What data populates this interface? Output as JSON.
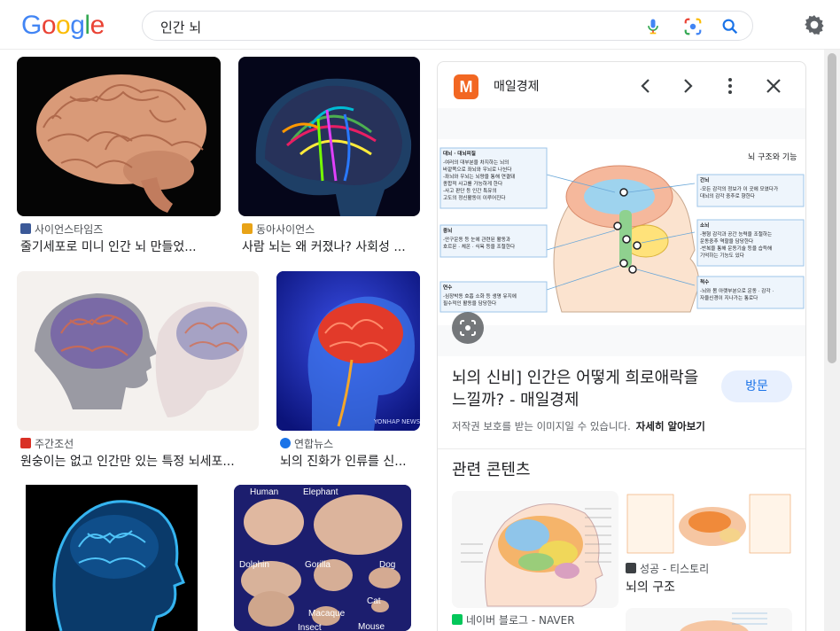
{
  "header": {
    "logo_letters": [
      "G",
      "o",
      "o",
      "g",
      "l",
      "e"
    ],
    "logo_colors": [
      "#4285F4",
      "#EA4335",
      "#FBBC05",
      "#4285F4",
      "#34A853",
      "#EA4335"
    ],
    "search_query": "인간 뇌"
  },
  "results": [
    {
      "source": "사이언스타임즈",
      "title": "줄기세포로 미니 인간 뇌 만들었...",
      "fav_color": "#3b5998"
    },
    {
      "source": "동아사이언스",
      "title": "사람 뇌는 왜 커졌나? 사회성 ...",
      "fav_color": "#e8a317"
    },
    {
      "source": "주간조선",
      "title": "원숭이는 없고 인간만 있는 특정 뇌세포...",
      "fav_color": "#d93025"
    },
    {
      "source": "연합뉴스",
      "title": "뇌의 진화가 인류를 신...",
      "fav_color": "#1a73e8"
    }
  ],
  "grid_image_labels": {
    "yonhap_watermark": "YONHAP NEWS",
    "species": [
      "Human",
      "Elephant",
      "Dolphin",
      "Gorilla",
      "Dog",
      "Cat",
      "Macaque",
      "Mouse",
      "Insect"
    ]
  },
  "panel": {
    "source_logo": "M",
    "source_name": "매일경제",
    "title": "뇌의 신비] 인간은 어떻게 희로애락을 느낄까? - 매일경제",
    "visit_label": "방문",
    "copyright_note": "저작권 보호를 받는 이미지일 수 있습니다.",
    "learn_more": "자세히 알아보기",
    "related_heading": "관련 콘텐츠",
    "diagram": {
      "heading": "뇌 구조와 기능",
      "boxes": [
        {
          "title": "대뇌 · 대뇌피질",
          "lines": [
            "-여러의 대부분을 차지하는 뇌의",
            "바깥쪽으로 좌뇌와 우뇌로 나뉜다",
            "-좌뇌와 우뇌는 뇌량을 통해 연결돼",
            "종합적 사고를 가능하게 한다",
            "-사고 판단 등 인간 특유의",
            "고도의 정신활동이 이루어진다"
          ]
        },
        {
          "title": "중뇌",
          "lines": [
            "-안구운동 등 눈에 관련된 활동과",
            "호르몬 · 체온 · 식욕 등을 조절한다"
          ]
        },
        {
          "title": "연수",
          "lines": [
            "-심장박동 호흡 소화 등 생명 유지에",
            "필수적인 활동을 담당한다"
          ]
        },
        {
          "title": "간뇌",
          "lines": [
            "-모든 감각의 정보가 이 곳에 모였다가",
            "대뇌의 감각 중추로 향한다"
          ]
        },
        {
          "title": "소뇌",
          "lines": [
            "-평형 감각과 공간 능력을 조절하는",
            "운동중추 역할을 담당한다",
            "-반복을 통해 운동기술 등을 습득해",
            "기억하는 기능도 있다"
          ]
        },
        {
          "title": "척수",
          "lines": [
            "-뇌와 몸 아랫부분으로 운동 · 감각 ·",
            "자율신경이 지나가는 통로다"
          ]
        }
      ]
    },
    "related": [
      {
        "source": "성공 - 티스토리",
        "title": "뇌의 구조"
      },
      {
        "source": "네이버 블로그 - NAVER",
        "title": ""
      }
    ]
  },
  "colors": {
    "accent": "#1a73e8",
    "brand": "#f26722"
  }
}
